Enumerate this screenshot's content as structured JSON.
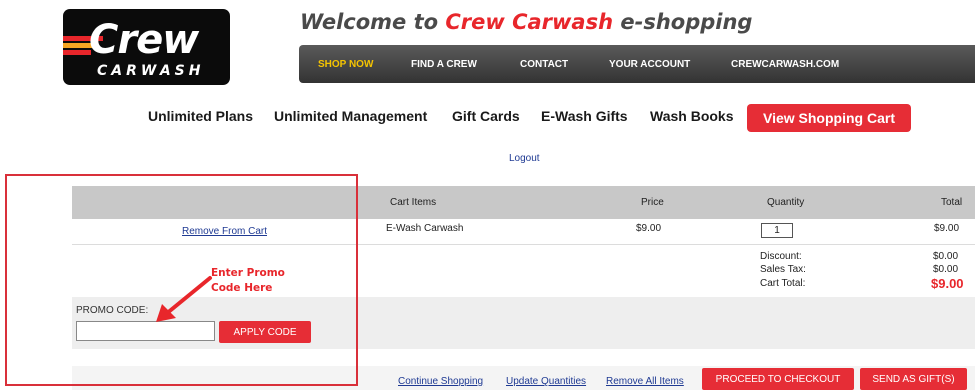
{
  "logo": {
    "brand": "Crew",
    "sub": "CARWASH"
  },
  "welcome": {
    "prefix": "Welcome to ",
    "accent": "Crew Carwash",
    "suffix": " e-shopping"
  },
  "top_nav": {
    "items": [
      "SHOP NOW",
      "FIND A CREW",
      "CONTACT",
      "YOUR ACCOUNT",
      "CREWCARWASH.COM"
    ],
    "active_color": "#f5c400"
  },
  "sub_nav": {
    "items": [
      "Unlimited Plans",
      "Unlimited Management",
      "Gift Cards",
      "E-Wash Gifts",
      "Wash Books"
    ],
    "cart_button": "View Shopping Cart"
  },
  "logout": "Logout",
  "cart": {
    "headers": {
      "items": "Cart Items",
      "price": "Price",
      "quantity": "Quantity",
      "total": "Total"
    },
    "row": {
      "remove": "Remove From Cart",
      "item": "E-Wash Carwash",
      "price": "$9.00",
      "qty": "1",
      "total": "$9.00"
    },
    "summary": {
      "discount_label": "Discount:",
      "discount": "$0.00",
      "tax_label": "Sales Tax:",
      "tax": "$0.00",
      "total_label": "Cart Total:",
      "total": "$9.00"
    }
  },
  "promo": {
    "label": "PROMO CODE:",
    "value": "",
    "apply": "APPLY CODE"
  },
  "footer": {
    "continue": "Continue Shopping",
    "update": "Update Quantities",
    "remove_all": "Remove All Items",
    "checkout": "PROCEED TO CHECKOUT",
    "gift": "SEND AS GIFT(S)"
  },
  "annotation": {
    "text": "Enter Promo\nCode Here"
  },
  "colors": {
    "accent": "#e62d36",
    "nav_dark": "#3a3a3a",
    "link": "#1f3a93"
  }
}
